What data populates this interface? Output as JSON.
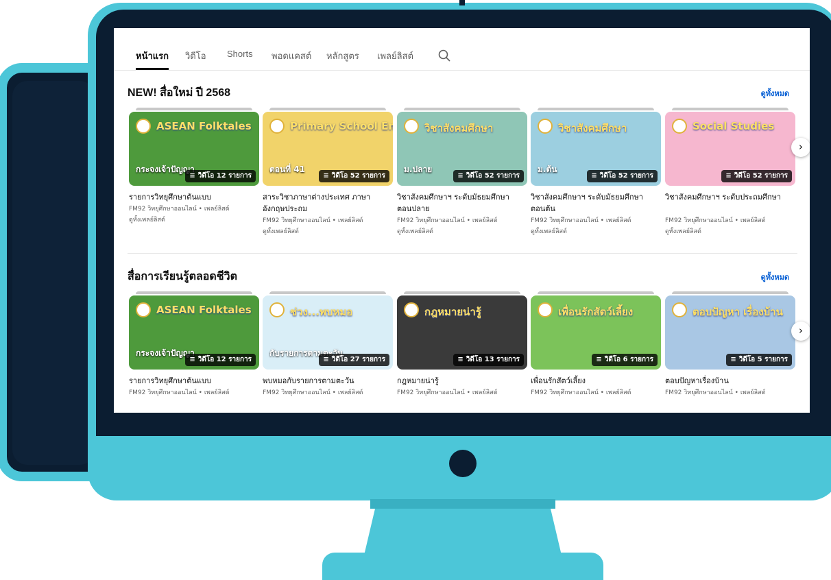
{
  "tabs": [
    {
      "label": "หน้าแรก",
      "active": true
    },
    {
      "label": "วิดีโอ"
    },
    {
      "label": "Shorts"
    },
    {
      "label": "พอดแคสต์"
    },
    {
      "label": "หลักสูตร"
    },
    {
      "label": "เพลย์ลิสต์"
    }
  ],
  "sections": [
    {
      "title": "NEW! สื่อใหม่ ปี 2568",
      "see_all": "ดูทั้งหมด",
      "cards": [
        {
          "thumb_text": "ASEAN Folktales",
          "thumb_sub": "กระจงเจ้าปัญญา",
          "count": "วิดีโอ 12 รายการ",
          "title": "รายการวิทยุศึกษาต้นแบบ",
          "meta1": "FM92 วิทยุศึกษาออนไลน์ • เพลย์ลิสต์",
          "meta2": "ดูทั้งเพลย์ลิสต์",
          "bg": "#4e9a3c"
        },
        {
          "thumb_text": "Primary School English",
          "thumb_sub": "ตอนที่ 41",
          "count": "วิดีโอ 52 รายการ",
          "title": "สาระวิชาภาษาต่างประเทศ ภาษาอังกฤษประถม",
          "meta1": "FM92 วิทยุศึกษาออนไลน์ • เพลย์ลิสต์",
          "meta2": "ดูทั้งเพลย์ลิสต์",
          "bg": "#f1d36a"
        },
        {
          "thumb_text": "วิชาสังคมศึกษา",
          "thumb_sub": "ม.ปลาย",
          "count": "วิดีโอ 52 รายการ",
          "title": "วิชาสังคมศึกษาฯ ระดับมัธยมศึกษาตอนปลาย",
          "meta1": "FM92 วิทยุศึกษาออนไลน์ • เพลย์ลิสต์",
          "meta2": "ดูทั้งเพลย์ลิสต์",
          "bg": "#8fc6b6"
        },
        {
          "thumb_text": "วิชาสังคมศึกษา",
          "thumb_sub": "ม.ต้น",
          "count": "วิดีโอ 52 รายการ",
          "title": "วิชาสังคมศึกษาฯ ระดับมัธยมศึกษาตอนต้น",
          "meta1": "FM92 วิทยุศึกษาออนไลน์ • เพลย์ลิสต์",
          "meta2": "ดูทั้งเพลย์ลิสต์",
          "bg": "#9ccfe0"
        },
        {
          "thumb_text": "Social Studies",
          "thumb_sub": "",
          "count": "วิดีโอ 52 รายการ",
          "title": "วิชาสังคมศึกษาฯ ระดับประถมศึกษา",
          "meta1": "FM92 วิทยุศึกษาออนไลน์ • เพลย์ลิสต์",
          "meta2": "ดูทั้งเพลย์ลิสต์",
          "bg": "#f6b7cf"
        }
      ]
    },
    {
      "title": "สื่อการเรียนรู้ตลอดชีวิต",
      "see_all": "ดูทั้งหมด",
      "cards": [
        {
          "thumb_text": "ASEAN Folktales",
          "thumb_sub": "กระจงเจ้าปัญญา",
          "count": "วิดีโอ 12 รายการ",
          "title": "รายการวิทยุศึกษาต้นแบบ",
          "meta1": "FM92 วิทยุศึกษาออนไลน์ • เพลย์ลิสต์",
          "bg": "#4e9a3c"
        },
        {
          "thumb_text": "ช่วง...พบหมอ",
          "thumb_sub": "กับรายการตามตะวัน",
          "count": "วิดีโอ 27 รายการ",
          "title": "พบหมอกับรายการตามตะวัน",
          "meta1": "FM92 วิทยุศึกษาออนไลน์ • เพลย์ลิสต์",
          "bg": "#d9eef7"
        },
        {
          "thumb_text": "กฎหมายน่ารู้",
          "thumb_sub": "",
          "count": "วิดีโอ 13 รายการ",
          "title": "กฎหมายน่ารู้",
          "meta1": "FM92 วิทยุศึกษาออนไลน์ • เพลย์ลิสต์",
          "bg": "#3a3a3a"
        },
        {
          "thumb_text": "เพื่อนรักสัตว์เลี้ยง",
          "thumb_sub": "",
          "count": "วิดีโอ 6 รายการ",
          "title": "เพื่อนรักสัตว์เลี้ยง",
          "meta1": "FM92 วิทยุศึกษาออนไลน์ • เพลย์ลิสต์",
          "bg": "#7cc35a"
        },
        {
          "thumb_text": "ตอบปัญหา เรื่องบ้าน",
          "thumb_sub": "",
          "count": "วิดีโอ 5 รายการ",
          "title": "ตอบปัญหาเรื่องบ้าน",
          "meta1": "FM92 วิทยุศึกษาออนไลน์ • เพลย์ลิสต์",
          "bg": "#a9c7e4"
        }
      ]
    }
  ],
  "next_arrow": "›",
  "playlist_glyph": "≡",
  "colors": {
    "accent": "#4cc6d8",
    "frame_dark": "#0b1d31",
    "link": "#065fd4"
  }
}
